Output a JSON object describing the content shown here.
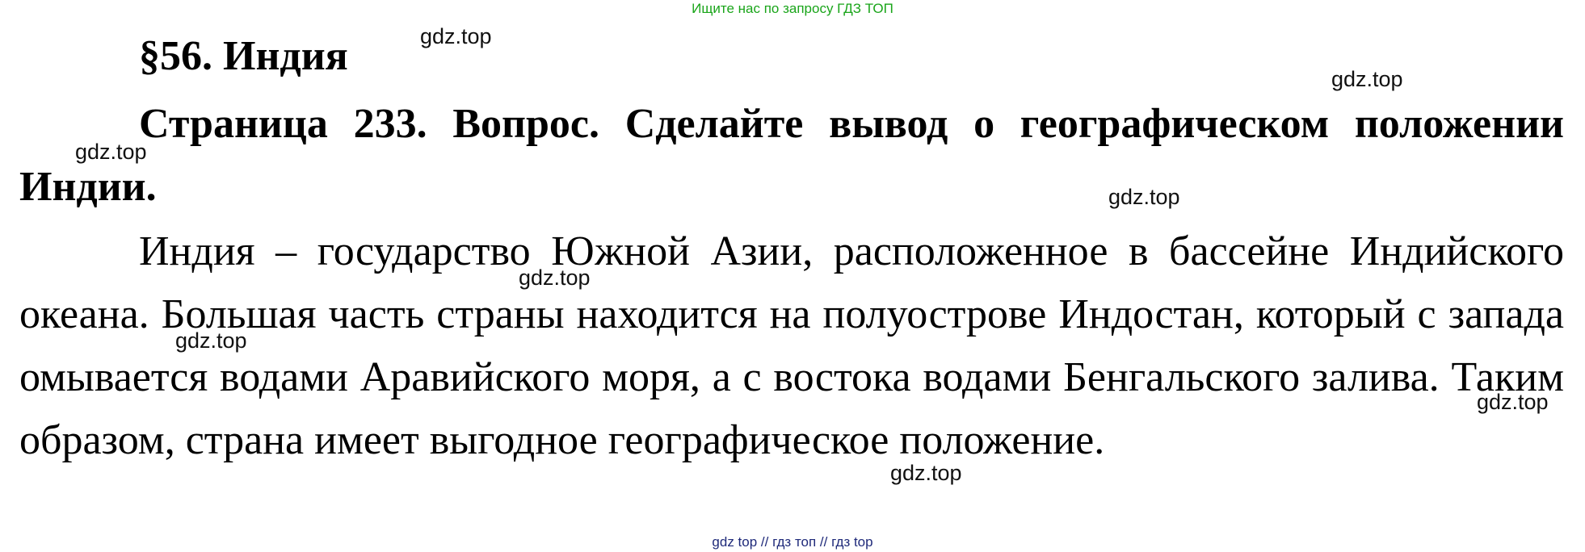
{
  "banner": "Ищите нас по запросу ГДЗ ТОП",
  "heading": "§56. Индия",
  "question": "Страница 233. Вопрос. Сделайте вывод о географическом положении Индии.",
  "answer": "Индия – государство Южной Азии, расположенное в бассейне Индийского океана. Большая часть страны находится на полуострове Индостан, который с запада омывается водами Аравийского моря, а с востока водами Бенгальского залива. Таким образом, страна имеет выгодное географическое положение.",
  "watermarks": [
    "gdz.top",
    "gdz.top",
    "gdz.top",
    "gdz.top",
    "gdz.top",
    "gdz.top",
    "gdz.top",
    "gdz.top"
  ],
  "footer": "gdz top  //  гдз топ  //  гдз top"
}
